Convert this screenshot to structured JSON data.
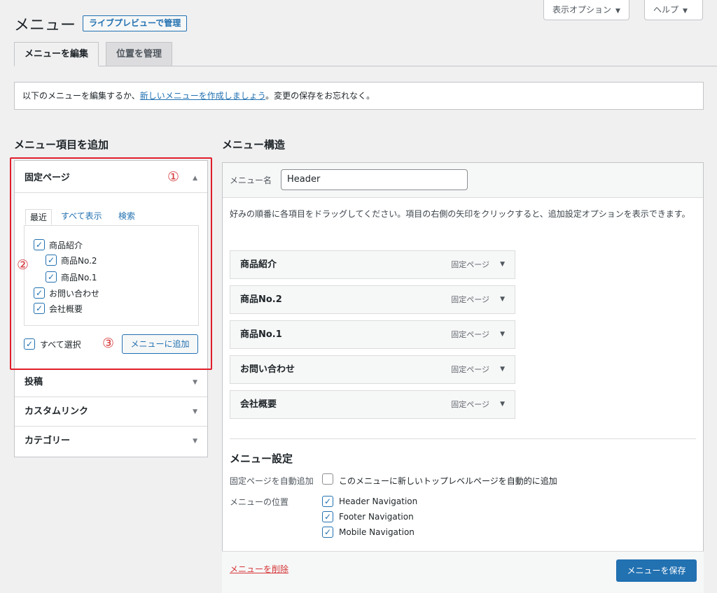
{
  "header": {
    "title": "メニュー",
    "preview_button": "ライブプレビューで管理",
    "screen_options": "表示オプション",
    "help": "ヘルプ"
  },
  "tabs": [
    {
      "label": "メニューを編集",
      "active": true
    },
    {
      "label": "位置を管理",
      "active": false
    }
  ],
  "notice": {
    "before": "以下のメニューを編集するか、",
    "link": "新しいメニューを作成しましょう",
    "after": "。変更の保存をお忘れなく。"
  },
  "add_items": {
    "title": "メニュー項目を追加",
    "pages_panel": {
      "title": "固定ページ",
      "subtabs": [
        "最近",
        "すべて表示",
        "検索"
      ],
      "items": [
        {
          "label": "商品紹介",
          "checked": true
        },
        {
          "label": "商品No.2",
          "checked": true
        },
        {
          "label": "商品No.1",
          "checked": true
        },
        {
          "label": "お問い合わせ",
          "checked": true
        },
        {
          "label": "会社概要",
          "checked": true
        }
      ],
      "select_all": "すべて選択",
      "add_button": "メニューに追加"
    },
    "other_panels": [
      "投稿",
      "カスタムリンク",
      "カテゴリー"
    ]
  },
  "annotations": {
    "one": "①",
    "two": "②",
    "three": "③"
  },
  "menu_structure": {
    "title": "メニュー構造",
    "name_label": "メニュー名",
    "name_value": "Header",
    "help_text": "好みの順番に各項目をドラッグしてください。項目の右側の矢印をクリックすると、追加設定オプションを表示できます。",
    "items": [
      {
        "label": "商品紹介",
        "type": "固定ページ"
      },
      {
        "label": "商品No.2",
        "type": "固定ページ"
      },
      {
        "label": "商品No.1",
        "type": "固定ページ"
      },
      {
        "label": "お問い合わせ",
        "type": "固定ページ"
      },
      {
        "label": "会社概要",
        "type": "固定ページ"
      }
    ]
  },
  "menu_settings": {
    "title": "メニュー設定",
    "auto_add_label": "固定ページを自動追加",
    "auto_add_text": "このメニューに新しいトップレベルページを自動的に追加",
    "auto_add_checked": false,
    "location_label": "メニューの位置",
    "locations": [
      {
        "label": "Header Navigation",
        "checked": true
      },
      {
        "label": "Footer Navigation",
        "checked": true
      },
      {
        "label": "Mobile Navigation",
        "checked": true
      }
    ]
  },
  "footer": {
    "delete_link": "メニューを削除",
    "save_button": "メニューを保存"
  },
  "colors": {
    "accent": "#2271b1",
    "highlight": "#e11d2b",
    "danger": "#d63638"
  }
}
